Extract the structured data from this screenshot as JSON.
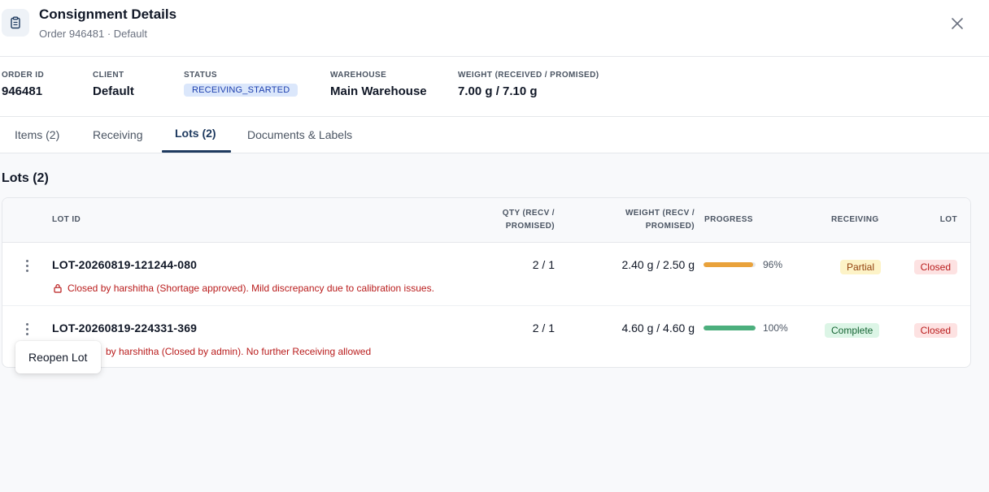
{
  "header": {
    "title": "Consignment Details",
    "subtitle": "Order 946481 · Default",
    "icon": "clipboard-icon",
    "close_icon": "close-icon"
  },
  "summary": {
    "order_id": {
      "label": "ORDER ID",
      "value": "946481"
    },
    "client": {
      "label": "CLIENT",
      "value": "Default"
    },
    "status": {
      "label": "STATUS",
      "value": "RECEIVING_STARTED"
    },
    "warehouse": {
      "label": "WAREHOUSE",
      "value": "Main Warehouse"
    },
    "weight": {
      "label": "WEIGHT (RECEIVED / PROMISED)",
      "value": "7.00 g / 7.10 g"
    }
  },
  "tabs": [
    {
      "label": "Items (2)",
      "active": false
    },
    {
      "label": "Receiving",
      "active": false
    },
    {
      "label": "Lots (2)",
      "active": true
    },
    {
      "label": "Documents & Labels",
      "active": false
    }
  ],
  "lots": {
    "title": "Lots (2)",
    "columns": {
      "lot_id": "LOT ID",
      "qty_1": "QTY (RECV /",
      "qty_2": "PROMISED)",
      "weight_1": "WEIGHT (RECV /",
      "weight_2": "PROMISED)",
      "progress": "PROGRESS",
      "receiving": "RECEIVING",
      "lot": "LOT"
    },
    "rows": [
      {
        "lot_id": "LOT-20260819-121244-080",
        "qty": "2 / 1",
        "weight": "2.40 g / 2.50 g",
        "progress": 0.96,
        "progress_label": "96%",
        "progress_color": "#e9a23b",
        "receiving": "Partial",
        "lot_status": "Closed",
        "note": "Closed by harshitha (Shortage approved). Mild discrepancy due to calibration issues.",
        "note_icon": "lock-icon"
      },
      {
        "lot_id": "LOT-20260819-224331-369",
        "qty": "2 / 1",
        "weight": "4.60 g / 4.60 g",
        "progress": 1.0,
        "progress_label": "100%",
        "progress_color": "#4caf7d",
        "receiving": "Complete",
        "lot_status": "Closed",
        "note": "by harshitha (Closed by admin). No further Receiving allowed"
      }
    ]
  },
  "context_menu": {
    "items": [
      "Reopen Lot"
    ]
  }
}
